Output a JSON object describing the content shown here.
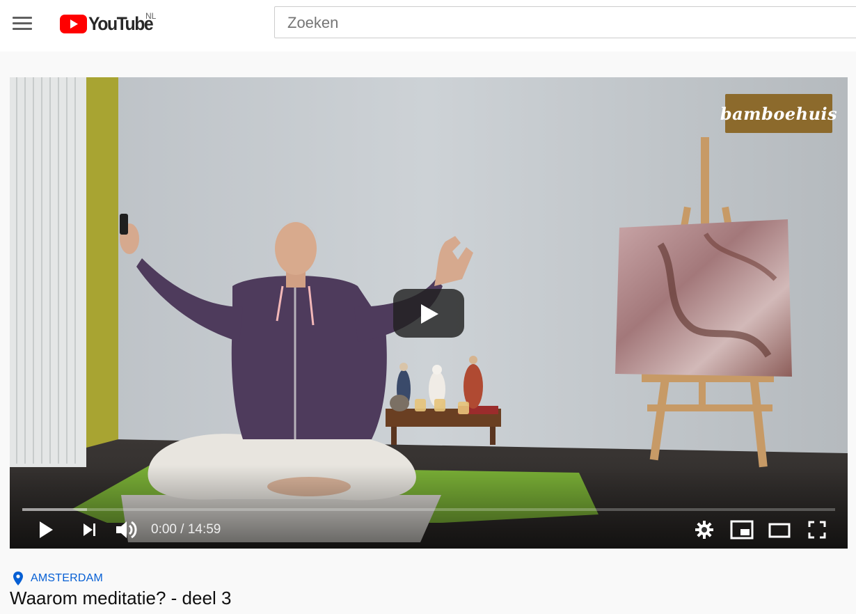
{
  "masthead": {
    "logo_text": "YouTube",
    "region": "NL",
    "search_placeholder": "Zoeken",
    "icons": [
      "menu-icon",
      "youtube-logo-icon"
    ]
  },
  "player": {
    "watermark": "bamboehuis",
    "time": {
      "current": "0:00",
      "separator": " / ",
      "duration": "14:59"
    },
    "loaded_fraction": 0.08,
    "controls": [
      "play-icon",
      "next-icon",
      "volume-icon",
      "settings-icon",
      "miniplayer-icon",
      "theater-mode-icon",
      "fullscreen-icon"
    ]
  },
  "video": {
    "location": "AMSTERDAM",
    "title": "Waarom meditatie? - deel 3"
  },
  "colors": {
    "brand_red": "#ff0000",
    "link_blue": "#065fd4",
    "watermark_bg": "#8c6a2c"
  }
}
